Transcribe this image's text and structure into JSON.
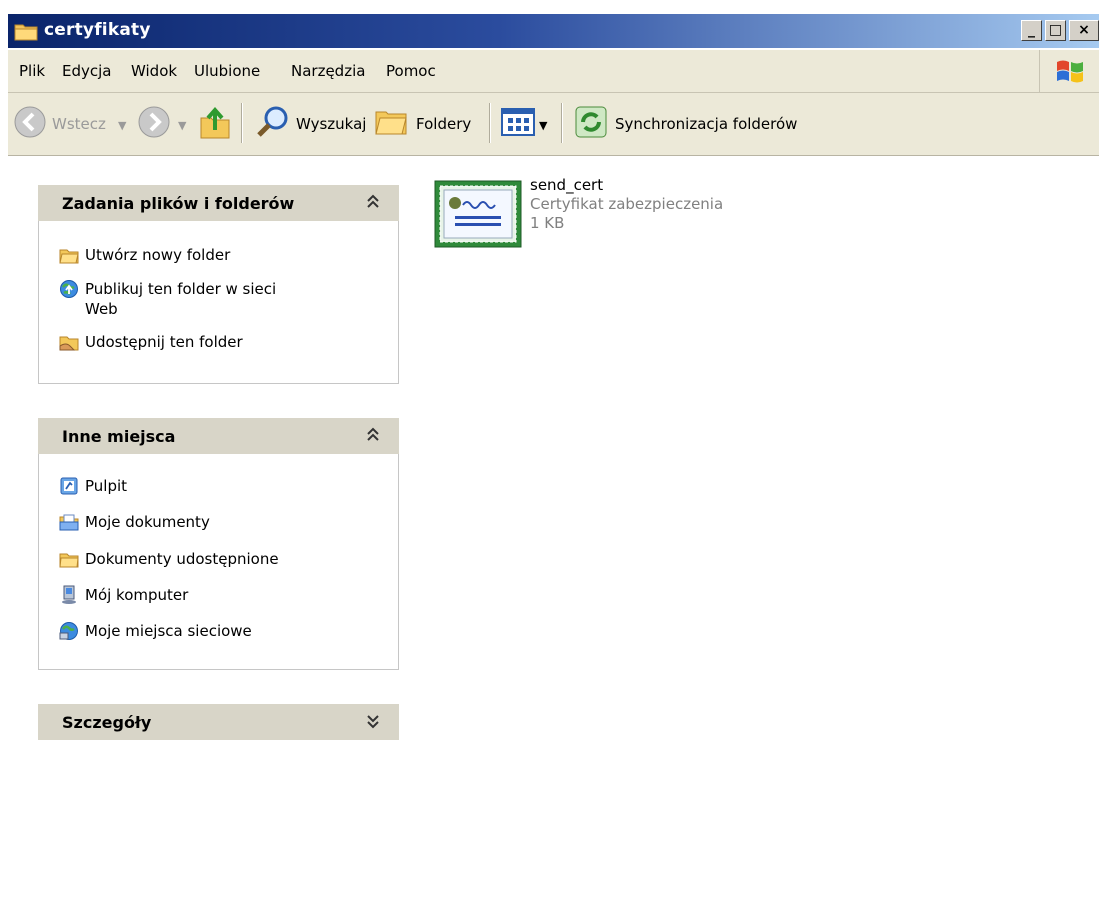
{
  "window": {
    "title": "certyfikaty",
    "minimize": "_",
    "maximize": "□",
    "close": "×"
  },
  "menu": [
    "Plik",
    "Edycja",
    "Widok",
    "Ulubione",
    "Narzędzia",
    "Pomoc"
  ],
  "toolbar": {
    "back": "Wstecz",
    "search": "Wyszukaj",
    "folders": "Foldery",
    "sync": "Synchronizacja folderów"
  },
  "panels": {
    "tasks": {
      "title": "Zadania plików i folderów",
      "items": [
        "Utwórz nowy folder",
        "Publikuj ten folder w sieci",
        "Web",
        "Udostępnij ten folder"
      ]
    },
    "places": {
      "title": "Inne miejsca",
      "items": [
        "Pulpit",
        "Moje dokumenty",
        "Dokumenty udostępnione",
        "Mój komputer",
        "Moje miejsca sieciowe"
      ]
    },
    "details": {
      "title": "Szczegóły"
    }
  },
  "file": {
    "name": "send_cert",
    "type": "Certyfikat zabezpieczenia",
    "size": "1 KB"
  },
  "colors": {
    "titlebar": "#0a246a",
    "chrome": "#ece9d8",
    "panel_header": "#d8d5c8",
    "muted_text": "#808080"
  }
}
